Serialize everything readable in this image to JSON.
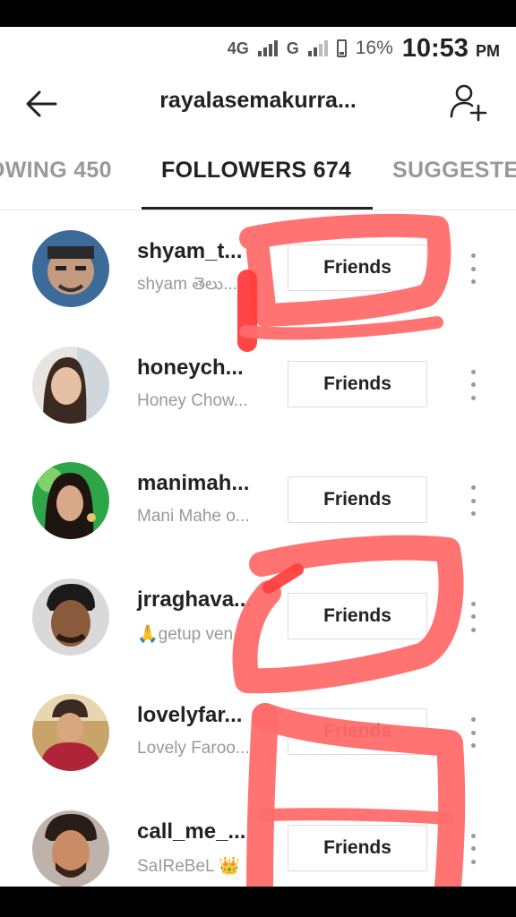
{
  "status_bar": {
    "network_1": "4G",
    "network_2": "G",
    "battery": "16%",
    "time": "10:53",
    "ampm": "PM"
  },
  "header": {
    "title": "rayalasemakurra..."
  },
  "tabs": [
    {
      "label": "OWING 450"
    },
    {
      "label": "FOLLOWERS 674"
    },
    {
      "label": "SUGGESTE"
    }
  ],
  "followers": [
    {
      "username": "shyam_t...",
      "display_name": "shyam తెలు...",
      "button": "Friends"
    },
    {
      "username": "honeych...",
      "display_name": "Honey Chow...",
      "button": "Friends"
    },
    {
      "username": "manimah...",
      "display_name": "Mani Mahe o...",
      "button": "Friends"
    },
    {
      "username": "jrraghava...",
      "display_name": "🙏getup ven...",
      "button": "Friends"
    },
    {
      "username": "lovelyfar...",
      "display_name": "Lovely Faroo...",
      "button": "Friends"
    },
    {
      "username": "call_me_...",
      "display_name": "SaIReBeL 👑",
      "button": "Friends"
    }
  ],
  "colors": {
    "annotation": "#ff6b6b",
    "text_primary": "#222222",
    "text_secondary": "#999999"
  }
}
